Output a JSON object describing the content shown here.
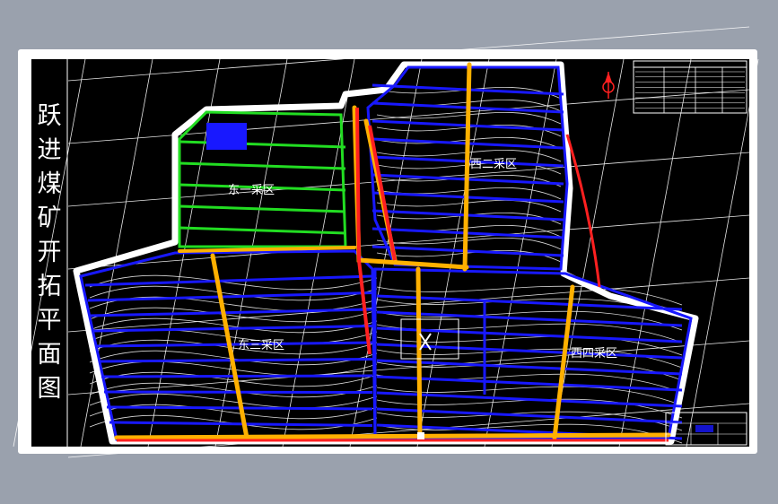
{
  "title_vertical": "跃进煤矿开拓平面图",
  "title_chars": [
    "跃",
    "进",
    "煤",
    "矿",
    "开",
    "拓",
    "平",
    "面",
    "图"
  ],
  "zones": {
    "east1": "东一采区",
    "west2": "西二采区",
    "east3": "东三采区",
    "west4": "西四采区"
  },
  "colors": {
    "page_bg": "#9aa1ad",
    "sheet_border": "#ffffff",
    "drawing_bg": "#000000",
    "panel_blue": "#1818ff",
    "panel_green": "#22dd22",
    "main_orange": "#ffb000",
    "roadway_red": "#ff2020",
    "mine_boundary": "#ffffff",
    "contour": "#ffffff",
    "label_text": "#ffffff"
  },
  "icons": {
    "north_arrow": "north-arrow-icon",
    "shaft": "shaft-icon"
  }
}
